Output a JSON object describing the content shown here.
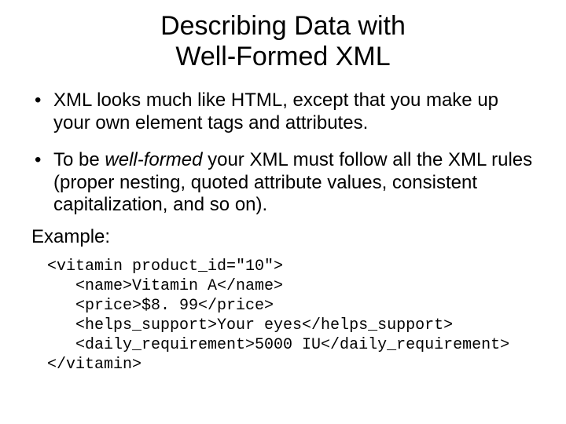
{
  "title_line1": "Describing Data with",
  "title_line2": "Well-Formed XML",
  "bullet1": "XML looks much like HTML, except that you make up your own element tags and attributes.",
  "bullet2_a": "To be ",
  "bullet2_em": "well-formed",
  "bullet2_b": " your XML must follow all the XML rules (proper nesting, quoted attribute values, consistent capitalization, and so on).",
  "example_label": "Example:",
  "code": {
    "l1": "<vitamin product_id=\"10\">",
    "l2": "   <name>Vitamin A</name>",
    "l3": "   <price>$8. 99</price>",
    "l4": "   <helps_support>Your eyes</helps_support>",
    "l5": "   <daily_requirement>5000 IU</daily_requirement>",
    "l6": "</vitamin>"
  }
}
